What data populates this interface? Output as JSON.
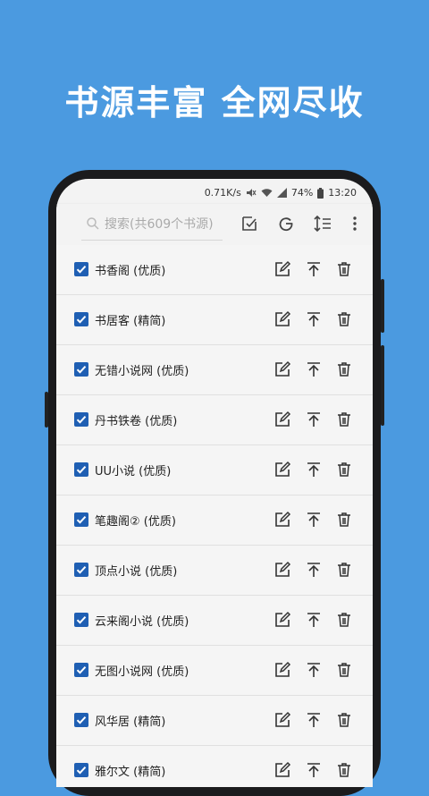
{
  "headline": "书源丰富  全网尽收",
  "status": {
    "speed": "0.71K/s",
    "battery": "74%",
    "time": "13:20"
  },
  "toolbar": {
    "search_placeholder": "搜索(共609个书源)"
  },
  "sources": [
    {
      "name": "书香阁 (优质)",
      "checked": true
    },
    {
      "name": "书居客 (精简)",
      "checked": true
    },
    {
      "name": "无错小说网 (优质)",
      "checked": true
    },
    {
      "name": "丹书铁卷 (优质)",
      "checked": true
    },
    {
      "name": "UU小说 (优质)",
      "checked": true
    },
    {
      "name": "笔趣阁② (优质)",
      "checked": true
    },
    {
      "name": "顶点小说 (优质)",
      "checked": true
    },
    {
      "name": "云来阁小说 (优质)",
      "checked": true
    },
    {
      "name": "无图小说网 (优质)",
      "checked": true
    },
    {
      "name": "风华居 (精简)",
      "checked": true
    },
    {
      "name": "雅尔文 (精简)",
      "checked": true
    }
  ],
  "colors": {
    "background": "#4b9ae0",
    "checkbox": "#1f5fb3",
    "screen": "#f3f3f3"
  }
}
